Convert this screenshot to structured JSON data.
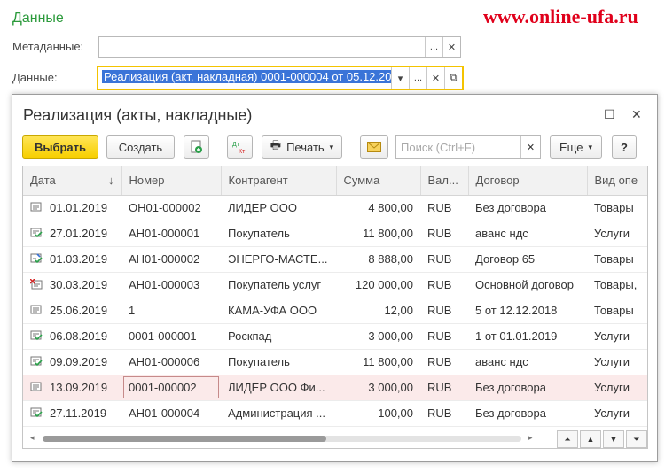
{
  "page": {
    "title": "Данные",
    "watermark": "www.online-ufa.ru"
  },
  "fields": {
    "metadata_label": "Метаданные:",
    "metadata_value": "",
    "data_label": "Данные:",
    "data_value": "Реализация (акт, накладная) 0001-000004 от 05.12.20"
  },
  "window": {
    "title": "Реализация (акты, накладные)",
    "toolbar": {
      "select": "Выбрать",
      "create": "Создать",
      "print": "Печать",
      "search_placeholder": "Поиск (Ctrl+F)",
      "more": "Еще",
      "help": "?"
    },
    "columns": [
      "Дата",
      "Номер",
      "Контрагент",
      "Сумма",
      "Вал...",
      "Договор",
      "Вид опе"
    ],
    "rows": [
      {
        "date": "01.01.2019",
        "number": "ОН01-000002",
        "counterparty": "ЛИДЕР ООО",
        "sum": "4 800,00",
        "currency": "RUB",
        "contract": "Без договора",
        "operation": "Товары",
        "icon": "doc-icon"
      },
      {
        "date": "27.01.2019",
        "number": "АН01-000001",
        "counterparty": "Покупатель",
        "sum": "11 800,00",
        "currency": "RUB",
        "contract": "аванс ндс",
        "operation": "Услуги",
        "icon": "doc-posted-icon"
      },
      {
        "date": "01.03.2019",
        "number": "АН01-000002",
        "counterparty": "ЭНЕРГО-МАСТЕ...",
        "sum": "8 888,00",
        "currency": "RUB",
        "contract": "Договор 65",
        "operation": "Товары",
        "icon": "doc-edited-icon"
      },
      {
        "date": "30.03.2019",
        "number": "АН01-000003",
        "counterparty": "Покупатель услуг",
        "sum": "120 000,00",
        "currency": "RUB",
        "contract": "Основной договор",
        "operation": "Товары,",
        "icon": "doc-deleted-icon"
      },
      {
        "date": "25.06.2019",
        "number": "1",
        "counterparty": "КАМА-УФА ООО",
        "sum": "12,00",
        "currency": "RUB",
        "contract": "5 от 12.12.2018",
        "operation": "Товары",
        "icon": "doc-icon"
      },
      {
        "date": "06.08.2019",
        "number": "0001-000001",
        "counterparty": "Роскпад",
        "sum": "3 000,00",
        "currency": "RUB",
        "contract": "1 от 01.01.2019",
        "operation": "Услуги",
        "icon": "doc-posted-icon"
      },
      {
        "date": "09.09.2019",
        "number": "АН01-000006",
        "counterparty": "Покупатель",
        "sum": "11 800,00",
        "currency": "RUB",
        "contract": "аванс ндс",
        "operation": "Услуги",
        "icon": "doc-posted-icon"
      },
      {
        "date": "13.09.2019",
        "number": "0001-000002",
        "counterparty": "ЛИДЕР ООО Фи...",
        "sum": "3 000,00",
        "currency": "RUB",
        "contract": "Без договора",
        "operation": "Услуги",
        "icon": "doc-icon"
      },
      {
        "date": "27.11.2019",
        "number": "АН01-000004",
        "counterparty": "Администрация ...",
        "sum": "100,00",
        "currency": "RUB",
        "contract": "Без договора",
        "operation": "Услуги",
        "icon": "doc-posted-icon"
      }
    ],
    "selected_row": 7
  },
  "colors": {
    "title_green": "#2b9a3b",
    "watermark_red": "#e0001b",
    "primary_yellow": "#f7cf00",
    "selection_blue": "#3a74d8",
    "posted_green": "#2aa04a",
    "deleted_red": "#d62020"
  }
}
